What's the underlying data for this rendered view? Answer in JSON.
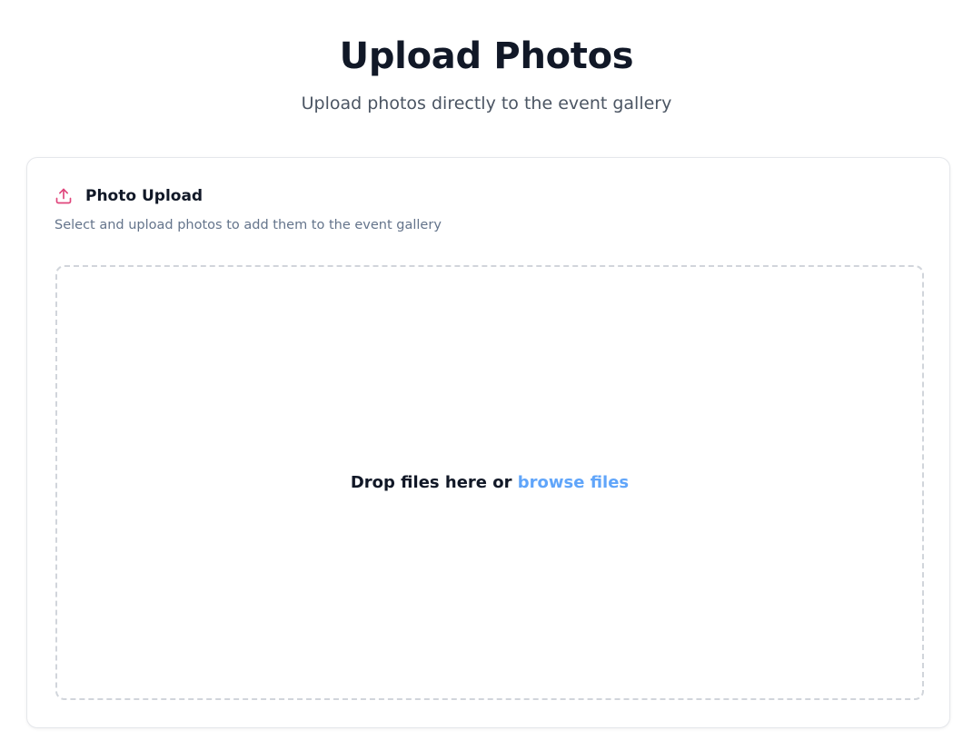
{
  "header": {
    "title": "Upload Photos",
    "subtitle": "Upload photos directly to the event gallery"
  },
  "card": {
    "icon": "upload-icon",
    "title": "Photo Upload",
    "description": "Select and upload photos to add them to the event gallery"
  },
  "dropzone": {
    "prompt": "Drop files here or",
    "browse_label": "browse files"
  },
  "colors": {
    "icon_accent": "#e0457b",
    "link": "#60a5fa",
    "muted_text": "#64748b",
    "dashed_border": "#d1d5db"
  }
}
